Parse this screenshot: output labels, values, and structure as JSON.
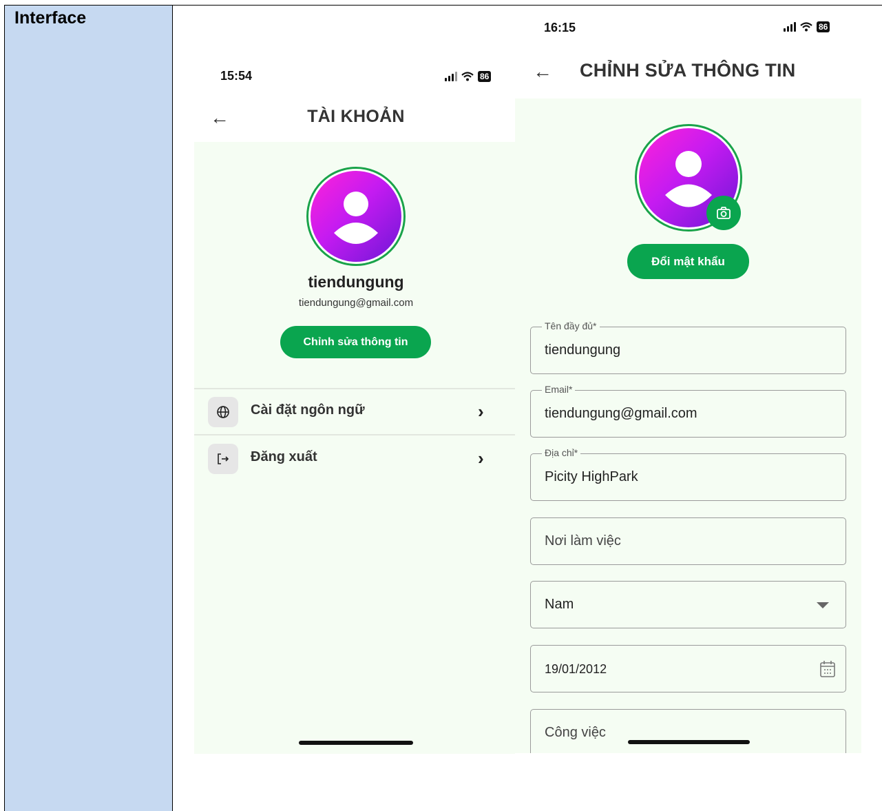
{
  "doc": {
    "label": "Interface"
  },
  "screen1": {
    "time": "15:54",
    "battery": "86",
    "title": "TÀI KHOẢN",
    "username": "tiendungung",
    "email": "tiendungung@gmail.com",
    "edit_button": "Chỉnh sửa thông tin",
    "menu": [
      {
        "label": "Cài đặt ngôn ngữ",
        "icon": "globe-icon"
      },
      {
        "label": "Đăng xuất",
        "icon": "logout-icon"
      }
    ]
  },
  "screen2": {
    "time": "16:15",
    "battery": "86",
    "title": "CHỈNH SỬA THÔNG TIN",
    "change_password": "Đổi mật khẩu",
    "fields": {
      "fullname": {
        "label": "Tên đầy đủ*",
        "value": "tiendungung"
      },
      "email": {
        "label": "Email*",
        "value": "tiendungung@gmail.com"
      },
      "address": {
        "label": "Địa chỉ*",
        "value": "Picity HighPark"
      },
      "workplace": {
        "placeholder": "Nơi làm việc"
      },
      "gender": {
        "value": "Nam"
      },
      "birthday": {
        "value": "19/01/2012"
      },
      "job": {
        "placeholder": "Công việc"
      }
    }
  },
  "colors": {
    "accent": "#0aa54f",
    "background": "#f5fdf3",
    "doc_column": "#c6d9f1"
  }
}
